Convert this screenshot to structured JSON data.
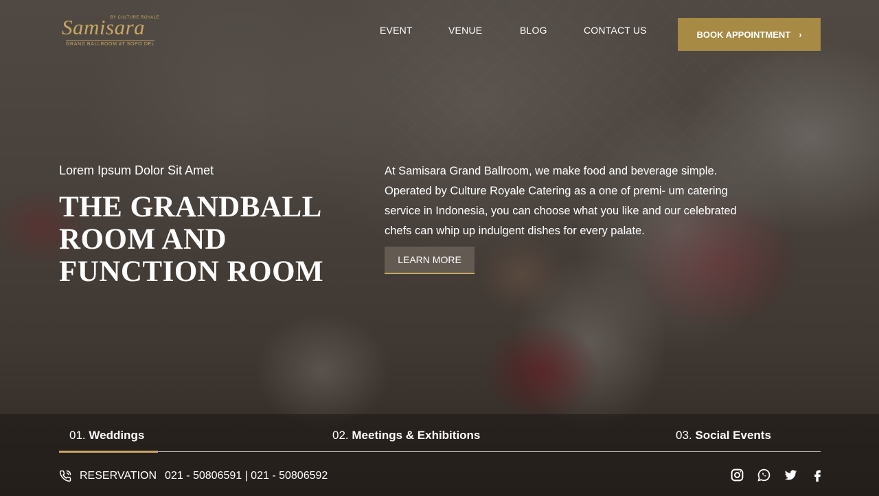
{
  "brand": {
    "name": "Samisara",
    "tagline_small": "BY CULTURE ROYALE",
    "subtitle": "GRAND BALLROOM AT SOPO DEL",
    "accent_color": "#a78a43"
  },
  "nav": {
    "items": [
      {
        "label": "EVENT"
      },
      {
        "label": "VENUE"
      },
      {
        "label": "BLOG"
      },
      {
        "label": "CONTACT US"
      }
    ],
    "cta_label": "BOOK APPOINTMENT"
  },
  "hero": {
    "kicker": "Lorem Ipsum Dolor Sit Amet",
    "headline_lines": [
      "THE GRANDBALL",
      "ROOM AND",
      "FUNCTION ROOM"
    ],
    "intro_lines": [
      "At Samisara Grand Ballroom, we make food and beverage simple.",
      "Operated by Culture Royale Catering as a one of premi- um catering",
      "service in Indonesia, you can choose what you like and our celebrated",
      "chefs can whip up indulgent dishes for every palate."
    ],
    "learn_more_label": "LEARN MORE"
  },
  "tabs": [
    {
      "num": "01.",
      "label": "Weddings",
      "active": true
    },
    {
      "num": "02.",
      "label": "Meetings & Exhibitions",
      "active": false
    },
    {
      "num": "03.",
      "label": "Social Events",
      "active": false
    }
  ],
  "footer": {
    "reservation_label": "RESERVATION",
    "phones": "021 - 50806591 | 021 - 50806592",
    "social_icons": [
      "instagram-icon",
      "whatsapp-icon",
      "twitter-icon",
      "facebook-icon"
    ]
  }
}
